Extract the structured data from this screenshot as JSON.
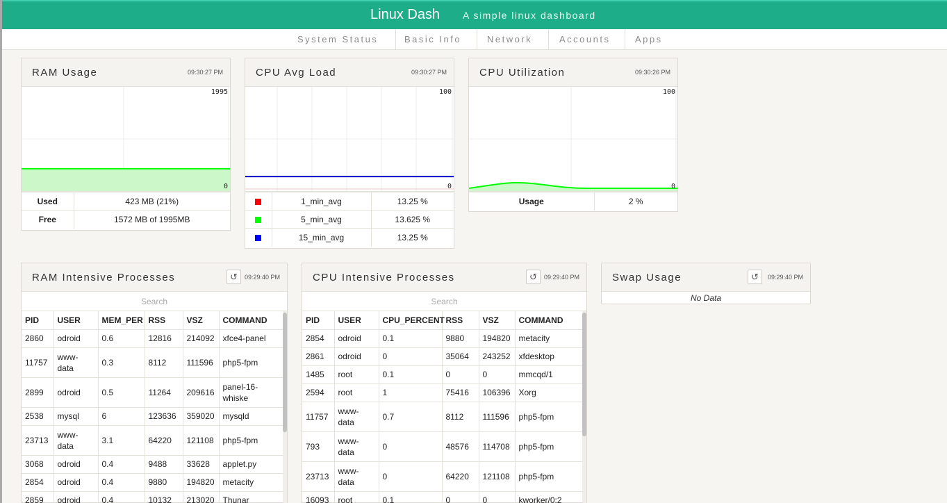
{
  "header": {
    "brand": "Linux Dash",
    "tagline": "A simple linux dashboard"
  },
  "nav": [
    "System Status",
    "Basic Info",
    "Network",
    "Accounts",
    "Apps"
  ],
  "ram_usage": {
    "title": "RAM Usage",
    "timestamp": "09:30:27 PM",
    "chart": {
      "max": "1995",
      "min": "0",
      "value": 423,
      "total": 1995
    },
    "rows": [
      {
        "label": "Used",
        "value": "423 MB (21%)"
      },
      {
        "label": "Free",
        "value": "1572 MB of 1995MB"
      }
    ]
  },
  "cpu_avg_load": {
    "title": "CPU Avg Load",
    "timestamp": "09:30:27 PM",
    "chart": {
      "max": "100",
      "min": "0",
      "value": 13.25
    },
    "rows": [
      {
        "color": "#ff0000",
        "label": "1_min_avg",
        "value": "13.25 %"
      },
      {
        "color": "#00ff00",
        "label": "5_min_avg",
        "value": "13.625 %"
      },
      {
        "color": "#0000ff",
        "label": "15_min_avg",
        "value": "13.25 %"
      }
    ]
  },
  "cpu_utilization": {
    "title": "CPU Utilization",
    "timestamp": "09:30:26 PM",
    "chart": {
      "max": "100",
      "min": "0",
      "value": 2
    },
    "rows": [
      {
        "label": "Usage",
        "value": "2 %"
      }
    ]
  },
  "ram_processes": {
    "title": "RAM Intensive Processes",
    "timestamp": "09:29:40 PM",
    "search_placeholder": "Search",
    "columns": [
      "PID",
      "USER",
      "MEM_PER",
      "RSS",
      "VSZ",
      "COMMAND"
    ],
    "rows": [
      [
        "2860",
        "odroid",
        "0.6",
        "12816",
        "214092",
        "xfce4-panel"
      ],
      [
        "11757",
        "www-data",
        "0.3",
        "8112",
        "111596",
        "php5-fpm"
      ],
      [
        "2899",
        "odroid",
        "0.5",
        "11264",
        "209616",
        "panel-16-whiske"
      ],
      [
        "2538",
        "mysql",
        "6",
        "123636",
        "359020",
        "mysqld"
      ],
      [
        "23713",
        "www-data",
        "3.1",
        "64220",
        "121108",
        "php5-fpm"
      ],
      [
        "3068",
        "odroid",
        "0.4",
        "9488",
        "33628",
        "applet.py"
      ],
      [
        "2854",
        "odroid",
        "0.4",
        "9880",
        "194820",
        "metacity"
      ],
      [
        "2859",
        "odroid",
        "0.4",
        "10132",
        "213020",
        "Thunar"
      ]
    ]
  },
  "cpu_processes": {
    "title": "CPU Intensive Processes",
    "timestamp": "09:29:40 PM",
    "search_placeholder": "Search",
    "columns": [
      "PID",
      "USER",
      "CPU_PERCENT",
      "RSS",
      "VSZ",
      "COMMAND"
    ],
    "rows": [
      [
        "2854",
        "odroid",
        "0.1",
        "9880",
        "194820",
        "metacity"
      ],
      [
        "2861",
        "odroid",
        "0",
        "35064",
        "243252",
        "xfdesktop"
      ],
      [
        "1485",
        "root",
        "0.1",
        "0",
        "0",
        "mmcqd/1"
      ],
      [
        "2594",
        "root",
        "1",
        "75416",
        "106396",
        "Xorg"
      ],
      [
        "11757",
        "www-data",
        "0.7",
        "8112",
        "111596",
        "php5-fpm"
      ],
      [
        "793",
        "www-data",
        "0",
        "48576",
        "114708",
        "php5-fpm"
      ],
      [
        "23713",
        "www-data",
        "0",
        "64220",
        "121108",
        "php5-fpm"
      ],
      [
        "16093",
        "root",
        "0.1",
        "0",
        "0",
        "kworker/0:2"
      ]
    ]
  },
  "swap_usage": {
    "title": "Swap Usage",
    "timestamp": "09:29:40 PM",
    "message": "No Data"
  },
  "colors": {
    "accent": "#1dad88",
    "ram_line": "#00ff00",
    "load_line": "#0000ff",
    "cpu_line": "#00ff00"
  }
}
